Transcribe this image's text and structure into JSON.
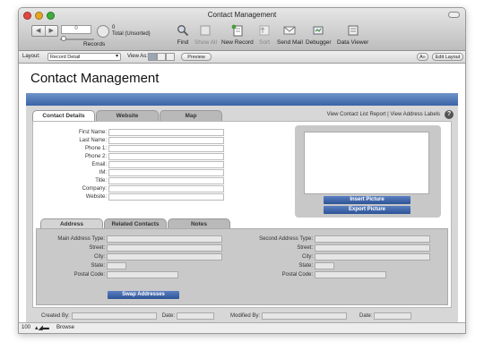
{
  "window": {
    "title": "Contact Management"
  },
  "toolbar": {
    "record_number": "0",
    "found_count": "0",
    "found_status": "Total (Unsorted)",
    "records_label": "Records",
    "buttons": [
      {
        "label": "Find",
        "icon": "magnifier-icon",
        "enabled": true
      },
      {
        "label": "Show All",
        "icon": "show-all-icon",
        "enabled": false
      },
      {
        "label": "New Record",
        "icon": "new-record-icon",
        "enabled": true
      },
      {
        "label": "Sort",
        "icon": "sort-icon",
        "enabled": false
      },
      {
        "label": "Send Mail",
        "icon": "envelope-icon",
        "enabled": true
      },
      {
        "label": "Debugger",
        "icon": "debugger-icon",
        "enabled": true
      },
      {
        "label": "Data Viewer",
        "icon": "data-viewer-icon",
        "enabled": true
      }
    ]
  },
  "layoutbar": {
    "layout_label": "Layout:",
    "layout_value": "Record Detail",
    "view_as_label": "View As:",
    "preview_label": "Preview",
    "font_toggle": "A»",
    "edit_layout_label": "Edit Layout"
  },
  "page": {
    "title": "Contact Management",
    "tabs": [
      "Contact Details",
      "Website",
      "Map"
    ],
    "top_links": "View Contact List Report  |  View Address Labels",
    "help": "?"
  },
  "contact_fields": [
    "First Name:",
    "Last Name:",
    "Phone 1:",
    "Phone 2:",
    "Email:",
    "IM:",
    "Title:",
    "Company:",
    "Website:"
  ],
  "picture": {
    "insert_label": "Insert Picture",
    "export_label": "Export Picture"
  },
  "address": {
    "tabs": [
      "Address",
      "Related Contacts",
      "Notes"
    ],
    "main_type_label": "Main Address Type:",
    "second_type_label": "Second Address Type:",
    "street_label": "Street:",
    "city_label": "City:",
    "state_label": "State:",
    "postal_label": "Postal Code:",
    "swap_label": "Swap Addresses"
  },
  "footer": {
    "created_by": "Created By:",
    "date": "Date:",
    "modified_by": "Modified By:"
  },
  "status": {
    "zoom": "100",
    "mode": "Browse"
  },
  "colors": {
    "header_blue": "#3b64a6",
    "button_blue": "#2e5497",
    "panel_gray": "#d7d7d7"
  }
}
